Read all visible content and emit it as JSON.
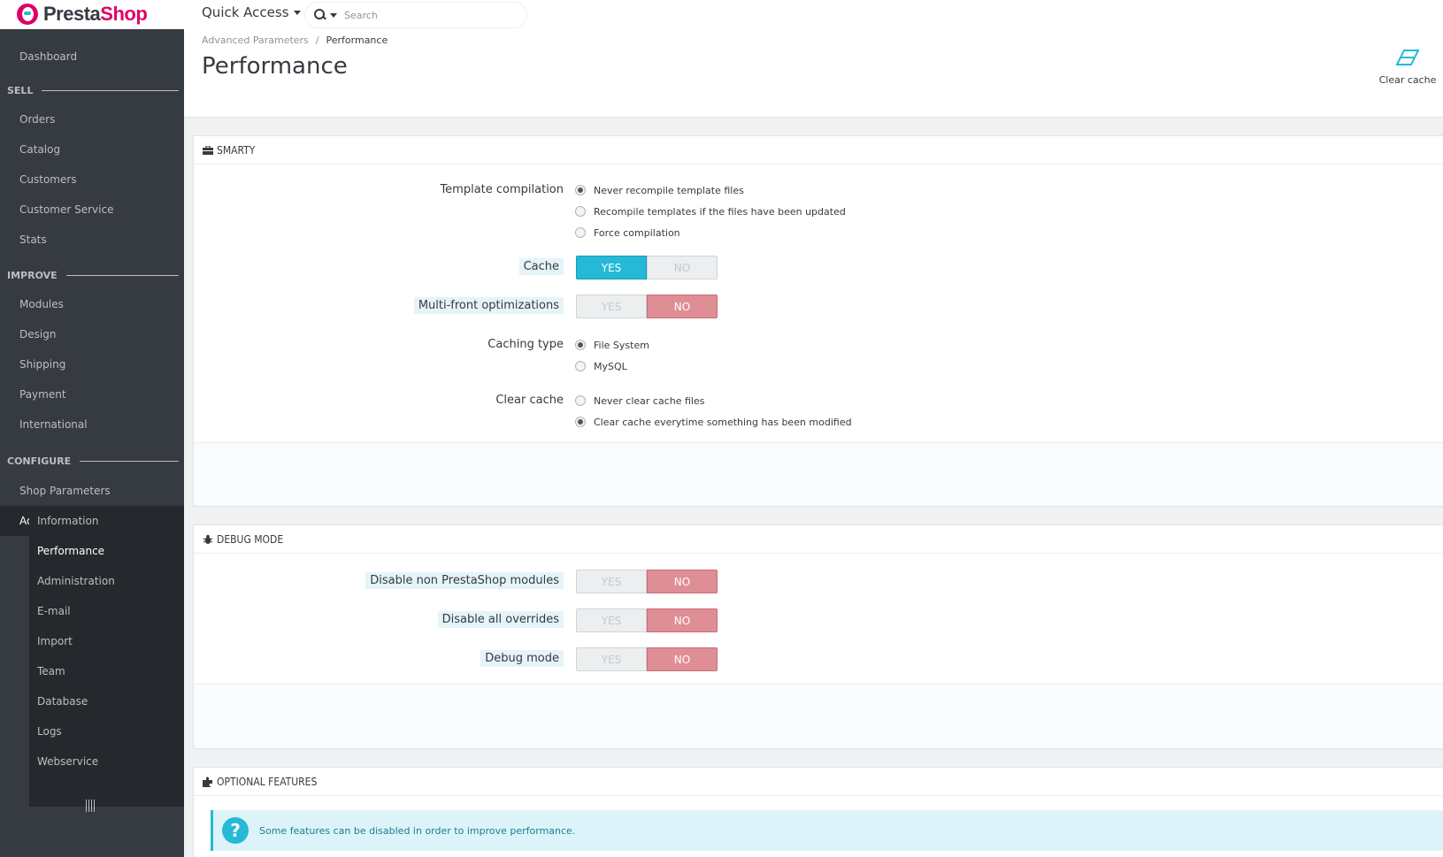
{
  "brand": {
    "part1": "Presta",
    "part2": "Shop"
  },
  "header": {
    "quick_access": "Quick Access",
    "search_placeholder": "Search"
  },
  "sidebar": {
    "dashboard": "Dashboard",
    "sections": [
      "SELL",
      "IMPROVE",
      "CONFIGURE"
    ],
    "sell": [
      "Orders",
      "Catalog",
      "Customers",
      "Customer Service",
      "Stats"
    ],
    "improve": [
      "Modules",
      "Design",
      "Shipping",
      "Payment",
      "International"
    ],
    "configure": [
      "Shop Parameters",
      "Advanced Parameters"
    ],
    "advanced_sub": [
      "Information",
      "Performance",
      "Administration",
      "E-mail",
      "Import",
      "Team",
      "Database",
      "Logs",
      "Webservice"
    ]
  },
  "breadcrumb": {
    "parent": "Advanced Parameters",
    "sep": "/",
    "current": "Performance"
  },
  "page_title": "Performance",
  "toolbar": {
    "clear_cache": "Clear cache"
  },
  "smarty": {
    "heading": "SMARTY",
    "template_compilation": {
      "label": "Template compilation",
      "options": [
        "Never recompile template files",
        "Recompile templates if the files have been updated",
        "Force compilation"
      ],
      "selected": 0
    },
    "cache": {
      "label": "Cache",
      "value": "YES"
    },
    "multi_front": {
      "label": "Multi-front optimizations",
      "value": "NO"
    },
    "caching_type": {
      "label": "Caching type",
      "options": [
        "File System",
        "MySQL"
      ],
      "selected": 0
    },
    "clear_cache": {
      "label": "Clear cache",
      "options": [
        "Never clear cache files",
        "Clear cache everytime something has been modified"
      ],
      "selected": 1
    }
  },
  "debug": {
    "heading": "DEBUG MODE",
    "disable_non_ps": {
      "label": "Disable non PrestaShop modules",
      "value": "NO"
    },
    "disable_overrides": {
      "label": "Disable all overrides",
      "value": "NO"
    },
    "debug_mode": {
      "label": "Debug mode",
      "value": "NO"
    }
  },
  "switch_labels": {
    "yes": "YES",
    "no": "NO"
  },
  "optional": {
    "heading": "OPTIONAL FEATURES",
    "help_symbol": "?",
    "info": "Some features can be disabled in order to improve performance."
  },
  "colors": {
    "accent": "#25b9d7",
    "brand": "#df0067",
    "no_active": "#e08e95",
    "sidebar_bg": "#363a41"
  }
}
